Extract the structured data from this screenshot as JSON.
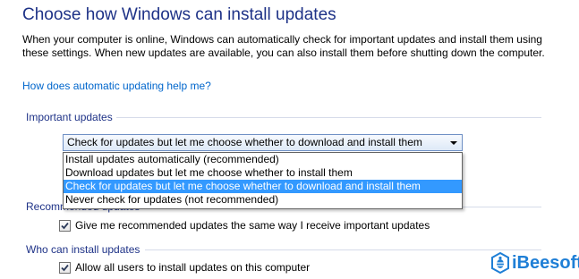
{
  "page": {
    "title": "Choose how Windows can install updates",
    "intro": "When your computer is online, Windows can automatically check for important updates and install them using these settings. When new updates are available, you can also install them before shutting down the computer.",
    "help_link": "How does automatic updating help me?"
  },
  "important_updates": {
    "label": "Important updates",
    "selected_value": "Check for updates but let me choose whether to download and install them",
    "options": [
      "Install updates automatically (recommended)",
      "Download updates but let me choose whether to install them",
      "Check for updates but let me choose whether to download and install them",
      "Never check for updates (not recommended)"
    ],
    "selected_index": 2
  },
  "recommended_updates": {
    "label": "Recommended updates",
    "checkbox_label": "Give me recommended updates the same way I receive important updates",
    "checked": true
  },
  "who_can_install": {
    "label": "Who can install updates",
    "checkbox_label": "Allow all users to install updates on this computer",
    "checked": true
  },
  "watermark": {
    "text": "iBeesoft",
    "color": "#1f7fd6"
  }
}
